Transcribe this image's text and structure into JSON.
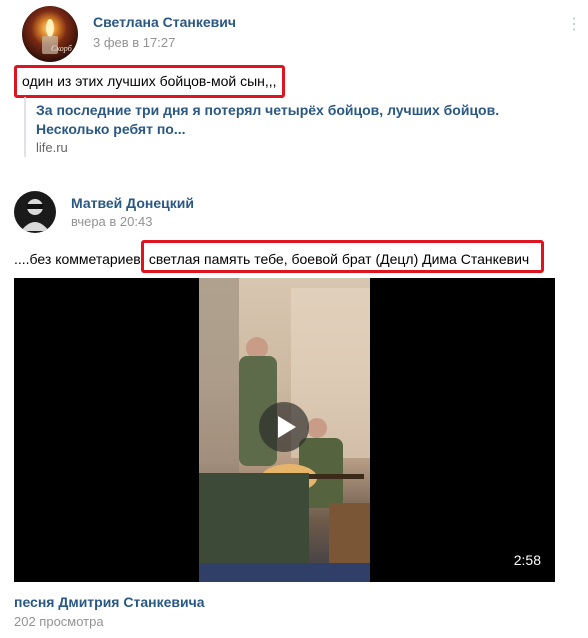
{
  "post1": {
    "author": "Светлана Станкевич",
    "date": "3 фев в 17:27",
    "text": "один из этих лучших бойцов-мой сын,,,",
    "link_title": "За последние три дня я потерял четырёх бойцов, лучших бойцов. Несколько ребят по...",
    "link_domain": "life.ru",
    "avatar_text": "Скорб"
  },
  "post2": {
    "author": "Матвей Донецкий",
    "date": "вчера в 20:43",
    "text_prefix": "....без комметариев,",
    "text_highlight": " светлая память тебе, боевой брат (Децл) Дима Станкевич",
    "video": {
      "duration": "2:58",
      "title": "песня Дмитрия Станкевича",
      "views": "202 просмотра"
    }
  },
  "menu_glyph": "⋮"
}
